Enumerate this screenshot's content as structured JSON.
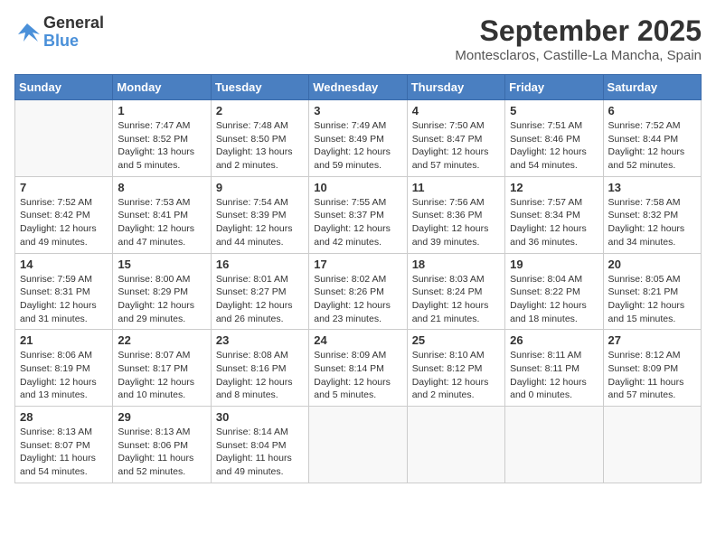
{
  "header": {
    "logo_line1": "General",
    "logo_line2": "Blue",
    "month": "September 2025",
    "location": "Montesclaros, Castille-La Mancha, Spain"
  },
  "weekdays": [
    "Sunday",
    "Monday",
    "Tuesday",
    "Wednesday",
    "Thursday",
    "Friday",
    "Saturday"
  ],
  "weeks": [
    [
      {
        "day": "",
        "empty": true
      },
      {
        "day": "1",
        "sunrise": "7:47 AM",
        "sunset": "8:52 PM",
        "daylight": "13 hours and 5 minutes."
      },
      {
        "day": "2",
        "sunrise": "7:48 AM",
        "sunset": "8:50 PM",
        "daylight": "13 hours and 2 minutes."
      },
      {
        "day": "3",
        "sunrise": "7:49 AM",
        "sunset": "8:49 PM",
        "daylight": "12 hours and 59 minutes."
      },
      {
        "day": "4",
        "sunrise": "7:50 AM",
        "sunset": "8:47 PM",
        "daylight": "12 hours and 57 minutes."
      },
      {
        "day": "5",
        "sunrise": "7:51 AM",
        "sunset": "8:46 PM",
        "daylight": "12 hours and 54 minutes."
      },
      {
        "day": "6",
        "sunrise": "7:52 AM",
        "sunset": "8:44 PM",
        "daylight": "12 hours and 52 minutes."
      }
    ],
    [
      {
        "day": "7",
        "sunrise": "7:52 AM",
        "sunset": "8:42 PM",
        "daylight": "12 hours and 49 minutes."
      },
      {
        "day": "8",
        "sunrise": "7:53 AM",
        "sunset": "8:41 PM",
        "daylight": "12 hours and 47 minutes."
      },
      {
        "day": "9",
        "sunrise": "7:54 AM",
        "sunset": "8:39 PM",
        "daylight": "12 hours and 44 minutes."
      },
      {
        "day": "10",
        "sunrise": "7:55 AM",
        "sunset": "8:37 PM",
        "daylight": "12 hours and 42 minutes."
      },
      {
        "day": "11",
        "sunrise": "7:56 AM",
        "sunset": "8:36 PM",
        "daylight": "12 hours and 39 minutes."
      },
      {
        "day": "12",
        "sunrise": "7:57 AM",
        "sunset": "8:34 PM",
        "daylight": "12 hours and 36 minutes."
      },
      {
        "day": "13",
        "sunrise": "7:58 AM",
        "sunset": "8:32 PM",
        "daylight": "12 hours and 34 minutes."
      }
    ],
    [
      {
        "day": "14",
        "sunrise": "7:59 AM",
        "sunset": "8:31 PM",
        "daylight": "12 hours and 31 minutes."
      },
      {
        "day": "15",
        "sunrise": "8:00 AM",
        "sunset": "8:29 PM",
        "daylight": "12 hours and 29 minutes."
      },
      {
        "day": "16",
        "sunrise": "8:01 AM",
        "sunset": "8:27 PM",
        "daylight": "12 hours and 26 minutes."
      },
      {
        "day": "17",
        "sunrise": "8:02 AM",
        "sunset": "8:26 PM",
        "daylight": "12 hours and 23 minutes."
      },
      {
        "day": "18",
        "sunrise": "8:03 AM",
        "sunset": "8:24 PM",
        "daylight": "12 hours and 21 minutes."
      },
      {
        "day": "19",
        "sunrise": "8:04 AM",
        "sunset": "8:22 PM",
        "daylight": "12 hours and 18 minutes."
      },
      {
        "day": "20",
        "sunrise": "8:05 AM",
        "sunset": "8:21 PM",
        "daylight": "12 hours and 15 minutes."
      }
    ],
    [
      {
        "day": "21",
        "sunrise": "8:06 AM",
        "sunset": "8:19 PM",
        "daylight": "12 hours and 13 minutes."
      },
      {
        "day": "22",
        "sunrise": "8:07 AM",
        "sunset": "8:17 PM",
        "daylight": "12 hours and 10 minutes."
      },
      {
        "day": "23",
        "sunrise": "8:08 AM",
        "sunset": "8:16 PM",
        "daylight": "12 hours and 8 minutes."
      },
      {
        "day": "24",
        "sunrise": "8:09 AM",
        "sunset": "8:14 PM",
        "daylight": "12 hours and 5 minutes."
      },
      {
        "day": "25",
        "sunrise": "8:10 AM",
        "sunset": "8:12 PM",
        "daylight": "12 hours and 2 minutes."
      },
      {
        "day": "26",
        "sunrise": "8:11 AM",
        "sunset": "8:11 PM",
        "daylight": "12 hours and 0 minutes."
      },
      {
        "day": "27",
        "sunrise": "8:12 AM",
        "sunset": "8:09 PM",
        "daylight": "11 hours and 57 minutes."
      }
    ],
    [
      {
        "day": "28",
        "sunrise": "8:13 AM",
        "sunset": "8:07 PM",
        "daylight": "11 hours and 54 minutes."
      },
      {
        "day": "29",
        "sunrise": "8:13 AM",
        "sunset": "8:06 PM",
        "daylight": "11 hours and 52 minutes."
      },
      {
        "day": "30",
        "sunrise": "8:14 AM",
        "sunset": "8:04 PM",
        "daylight": "11 hours and 49 minutes."
      },
      {
        "day": "",
        "empty": true
      },
      {
        "day": "",
        "empty": true
      },
      {
        "day": "",
        "empty": true
      },
      {
        "day": "",
        "empty": true
      }
    ]
  ]
}
